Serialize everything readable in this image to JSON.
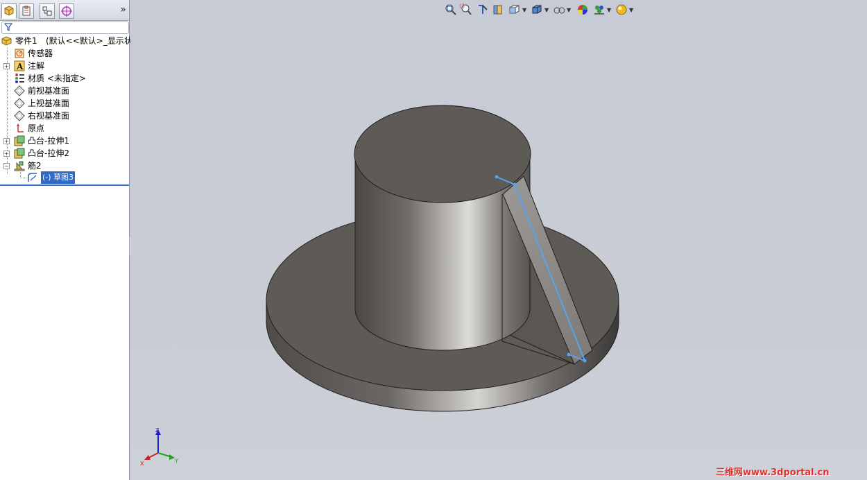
{
  "feature_manager": {
    "tabs": [
      {
        "name": "feature-tree",
        "icon": "feature-manager-icon"
      },
      {
        "name": "property-manager",
        "icon": "property-manager-icon"
      },
      {
        "name": "configuration-manager",
        "icon": "configuration-manager-icon"
      },
      {
        "name": "dimxpert-manager",
        "icon": "dimxpert-icon"
      }
    ],
    "more_glyph": "»",
    "filter_icon": "filter-icon",
    "root": {
      "label": "零件1",
      "config": "(默认<<默认>_显示状态"
    },
    "items": [
      {
        "label": "传感器",
        "icon": "sensor-icon",
        "expandable": false
      },
      {
        "label": "注解",
        "icon": "annotation-icon",
        "expandable": true
      },
      {
        "label": "材质 <未指定>",
        "icon": "material-icon",
        "expandable": false
      },
      {
        "label": "前视基准面",
        "icon": "plane-icon",
        "expandable": false
      },
      {
        "label": "上视基准面",
        "icon": "plane-icon",
        "expandable": false
      },
      {
        "label": "右视基准面",
        "icon": "plane-icon",
        "expandable": false
      },
      {
        "label": "原点",
        "icon": "origin-icon",
        "expandable": false
      },
      {
        "label": "凸台-拉伸1",
        "icon": "extrude-icon",
        "expandable": true
      },
      {
        "label": "凸台-拉伸2",
        "icon": "extrude-icon",
        "expandable": true
      },
      {
        "label": "筋2",
        "icon": "rib-icon",
        "expandable": true,
        "expanded": true
      }
    ],
    "child": {
      "label": "(-) 草图3",
      "icon": "sketch-icon",
      "selected": true
    },
    "expand_glyph": "+",
    "collapse_glyph": "−"
  },
  "view_toolbar": {
    "buttons": [
      {
        "name": "zoom-to-fit",
        "icon": "zoom-fit-icon"
      },
      {
        "name": "zoom-to-area",
        "icon": "zoom-area-icon"
      },
      {
        "name": "previous-view",
        "icon": "previous-view-icon"
      },
      {
        "name": "section-view",
        "icon": "section-view-icon"
      },
      {
        "name": "view-orientation",
        "icon": "view-orientation-icon"
      },
      {
        "name": "display-style",
        "icon": "display-style-icon"
      },
      {
        "name": "hide-show-items",
        "icon": "hide-show-icon"
      },
      {
        "name": "edit-appearance",
        "icon": "appearance-icon"
      },
      {
        "name": "apply-scene",
        "icon": "scene-icon"
      },
      {
        "name": "view-settings",
        "icon": "view-settings-icon"
      }
    ]
  },
  "triad": {
    "x": "X",
    "y": "Y",
    "z": "Z"
  },
  "watermark": "三维网www.3dportal.cn",
  "colors": {
    "background": "#c9ccd6",
    "model": "#5e5a56",
    "selection_blue": "#3169c6",
    "sketch_line": "#5aa3ee",
    "watermark": "#e0322b"
  }
}
